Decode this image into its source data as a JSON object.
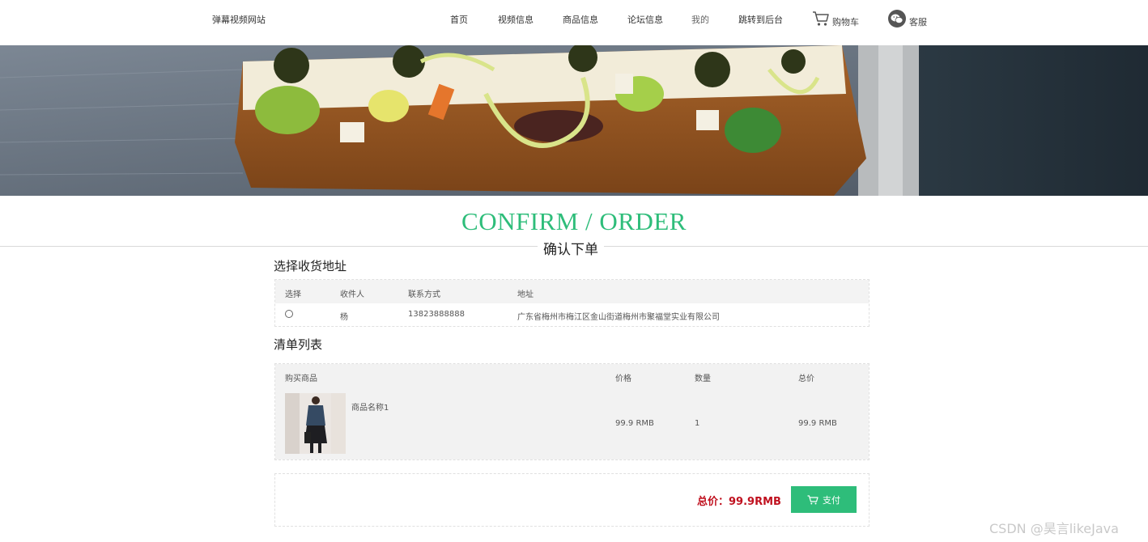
{
  "brand": "弹幕视频网站",
  "nav": {
    "home": "首页",
    "video": "视频信息",
    "product": "商品信息",
    "forum": "论坛信息",
    "mine": "我的",
    "admin": "跳转到后台",
    "cart": "购物车",
    "service": "客服"
  },
  "icons": {
    "cart": "shopping-cart-icon",
    "service": "wechat-icon",
    "pay": "shopping-cart-icon"
  },
  "heading": {
    "en": "CONFIRM / ORDER",
    "cn": "确认下单"
  },
  "address_section": {
    "title": "选择收货地址",
    "columns": [
      "选择",
      "收件人",
      "联系方式",
      "地址"
    ],
    "rows": [
      {
        "selected": false,
        "recipient": "杨",
        "phone": "13823888888",
        "address": "广东省梅州市梅江区金山街道梅州市聚福堂实业有限公司"
      }
    ]
  },
  "items_section": {
    "title": "清单列表",
    "columns": [
      "购买商品",
      "价格",
      "数量",
      "总价"
    ],
    "rows": [
      {
        "name": "商品名称1",
        "price": "99.9 RMB",
        "quantity": "1",
        "total": "99.9 RMB"
      }
    ]
  },
  "summary": {
    "total_label": "总价：99.9RMB",
    "pay_label": "支付"
  },
  "colors": {
    "accent": "#2ebd7a",
    "price_red": "#c0111f"
  },
  "watermark": "CSDN @昊言likeJava"
}
